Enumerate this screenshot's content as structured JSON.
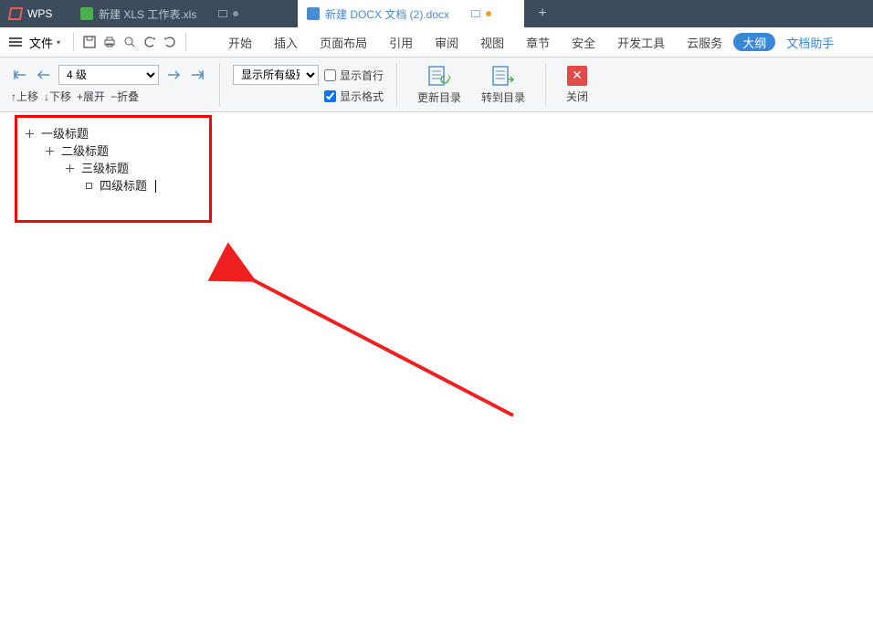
{
  "tabs": {
    "wps_label": "WPS",
    "xls_tab": "新建 XLS 工作表.xls",
    "docx_tab": "新建 DOCX 文档 (2).docx"
  },
  "menu": {
    "file": "文件",
    "items": [
      "开始",
      "插入",
      "页面布局",
      "引用",
      "审阅",
      "视图",
      "章节",
      "安全",
      "开发工具",
      "云服务"
    ],
    "active": "大纲",
    "helper": "文档助手"
  },
  "ribbon": {
    "level_value": "4 级",
    "show_levels": "显示所有级别",
    "chk_firstline": "显示首行",
    "chk_format": "显示格式",
    "update_toc": "更新目录",
    "goto_toc": "转到目录",
    "close": "关闭",
    "sub": {
      "up": "上移",
      "down": "下移",
      "expand": "展开",
      "collapse": "折叠"
    }
  },
  "outline": {
    "h1": "一级标题",
    "h2": "二级标题",
    "h3": "三级标题",
    "h4": "四级标题"
  }
}
